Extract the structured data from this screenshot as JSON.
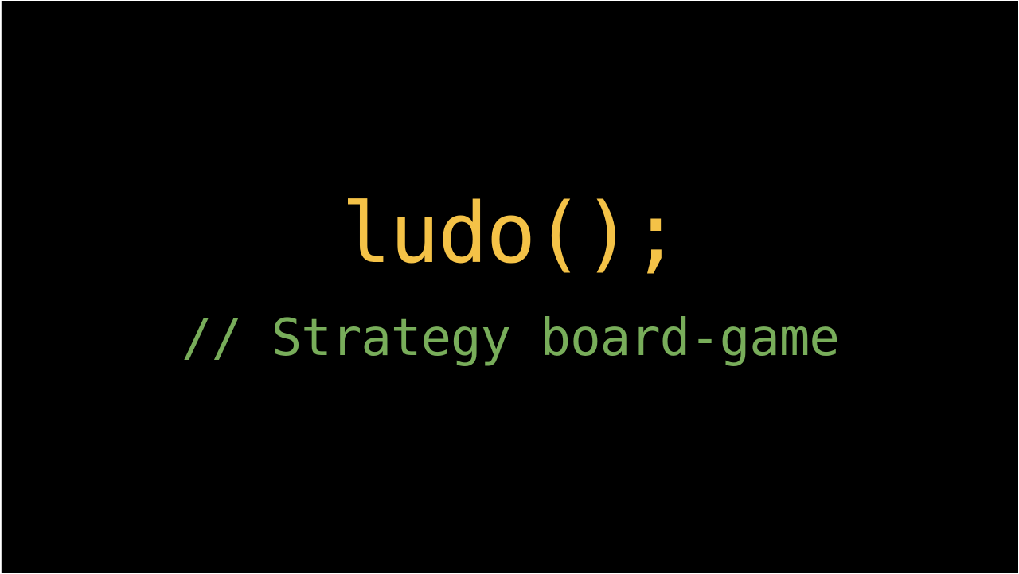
{
  "slide": {
    "title": "ludo();",
    "subtitle": "// Strategy board-game"
  },
  "colors": {
    "background": "#000000",
    "title": "#f4c247",
    "subtitle": "#78ad5a"
  }
}
